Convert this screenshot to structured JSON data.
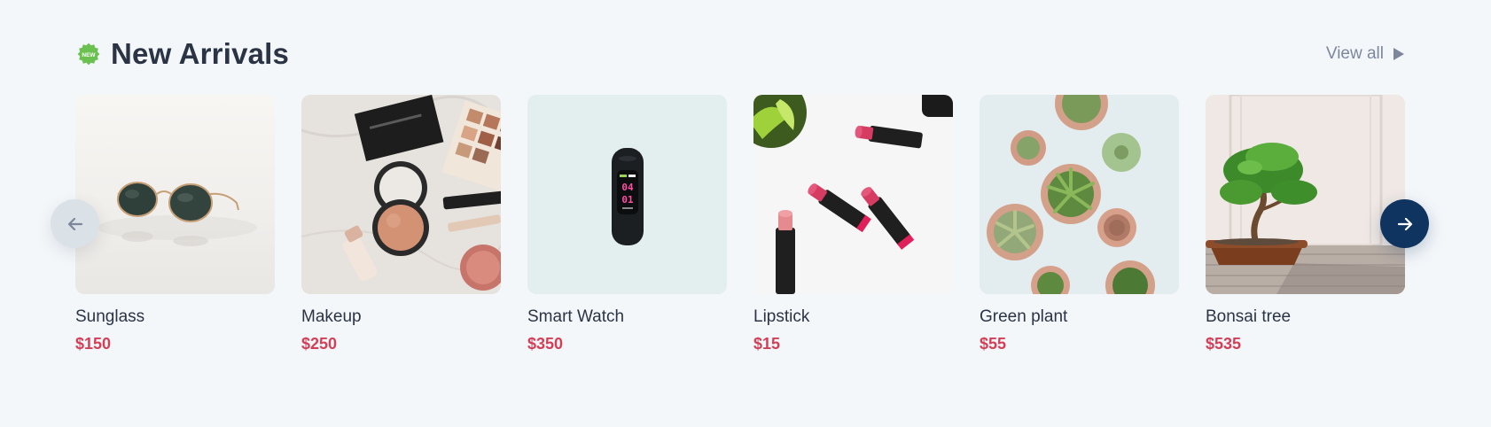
{
  "header": {
    "badge_text": "NEW",
    "title": "New Arrivals",
    "view_all_label": "View all"
  },
  "colors": {
    "background": "#f4f7fa",
    "price": "#d23f57",
    "next_button": "#0f3460",
    "prev_button": "#dae1e7",
    "badge": "#6ac14f"
  },
  "products": [
    {
      "name": "Sunglass",
      "price": "$150",
      "image": "sunglass-photo"
    },
    {
      "name": "Makeup",
      "price": "$250",
      "image": "makeup-photo"
    },
    {
      "name": "Smart Watch",
      "price": "$350",
      "image": "smart-watch-photo"
    },
    {
      "name": "Lipstick",
      "price": "$15",
      "image": "lipstick-photo"
    },
    {
      "name": "Green plant",
      "price": "$55",
      "image": "green-plant-photo"
    },
    {
      "name": "Bonsai tree",
      "price": "$535",
      "image": "bonsai-tree-photo"
    }
  ],
  "navigation": {
    "prev_icon": "arrow-left-icon",
    "next_icon": "arrow-right-icon"
  }
}
